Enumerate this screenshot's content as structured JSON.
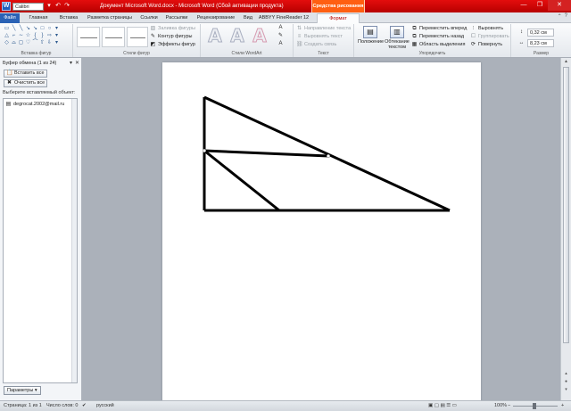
{
  "titlebar": {
    "quick_font": "Calibri (Осно",
    "quick_font_arrow": "▾",
    "undo_icon": "↶",
    "redo_icon": "↷",
    "title": "Документ Microsoft Word.docx  -  Microsoft Word (Сбой активации продукта)",
    "context_tab": "Средства рисования"
  },
  "tabs": [
    {
      "label": "Файл"
    },
    {
      "label": "Главная"
    },
    {
      "label": "Вставка"
    },
    {
      "label": "Разметка страницы"
    },
    {
      "label": "Ссылки"
    },
    {
      "label": "Рассылки"
    },
    {
      "label": "Рецензирование"
    },
    {
      "label": "Вид"
    },
    {
      "label": "ABBYY FineReader 12"
    },
    {
      "label": "Формат"
    }
  ],
  "ribbon": {
    "insert_shapes": {
      "label": "Вставка фигур"
    },
    "shape_styles": {
      "label": "Стили фигур",
      "fill": "Заливка фигуры",
      "outline": "Контур фигуры",
      "effects": "Эффекты фигур"
    },
    "wordart": {
      "label": "Стили WordArt",
      "letter": "A"
    },
    "text": {
      "label": "Текст",
      "direction": "Направление текста",
      "align": "Выровнять текст",
      "link": "Создать связь"
    },
    "arrange": {
      "label": "Упорядочить",
      "position": "Положение",
      "wrap_line1": "Обтекание",
      "wrap_line2": "текстом",
      "bring_forward": "Переместить вперед",
      "send_backward": "Переместить назад",
      "selection_pane": "Область выделения",
      "align": "Выровнять",
      "group": "Группировать",
      "rotate": "Повернуть"
    },
    "size": {
      "label": "Размер",
      "height": "0,32 см",
      "width": "8,23 см"
    }
  },
  "clipboard": {
    "title": "Буфер обмена (1 из 24)",
    "paste_all": "Вставить все",
    "clear_all": "Очистить все",
    "hint": "Выберите вставляемый объект:",
    "items": [
      {
        "text": "degrocat.2002@mail.ru"
      }
    ],
    "params": "Параметры"
  },
  "status": {
    "page": "Страница: 1 из 1",
    "words": "Число слов: 0",
    "lang": "русский",
    "zoom": "100%"
  },
  "colors": {
    "accent": "#c00000",
    "context": "#ff5f12",
    "file_tab": "#2a62b5"
  }
}
